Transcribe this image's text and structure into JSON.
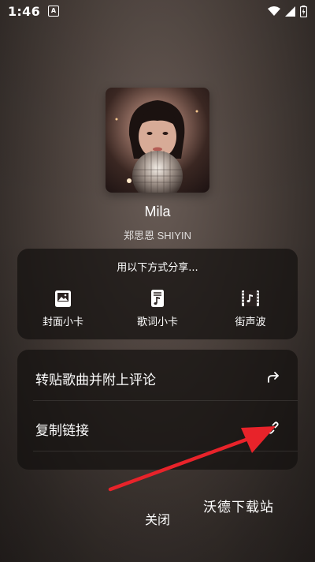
{
  "status_bar": {
    "time": "1:46",
    "notification_letter": "A",
    "icons": [
      "wifi-icon",
      "signal-icon",
      "battery-charging-icon"
    ]
  },
  "song": {
    "title": "Mila",
    "artist": "郑思恩 SHIYIN"
  },
  "share": {
    "heading": "用以下方式分享...",
    "items": [
      {
        "label": "封面小卡",
        "icon": "cover-card-icon"
      },
      {
        "label": "歌词小卡",
        "icon": "lyrics-card-icon"
      },
      {
        "label": "街声波",
        "icon": "street-voice-icon"
      }
    ]
  },
  "actions": [
    {
      "label": "转贴歌曲并附上评论",
      "icon": "forward-arrow-icon"
    },
    {
      "label": "复制链接",
      "icon": "link-icon"
    }
  ],
  "close_label": "关闭",
  "watermark": "沃德下载站",
  "colors": {
    "annotation_arrow": "#e8232a",
    "panel_bg": "rgba(20,16,15,0.72)"
  }
}
